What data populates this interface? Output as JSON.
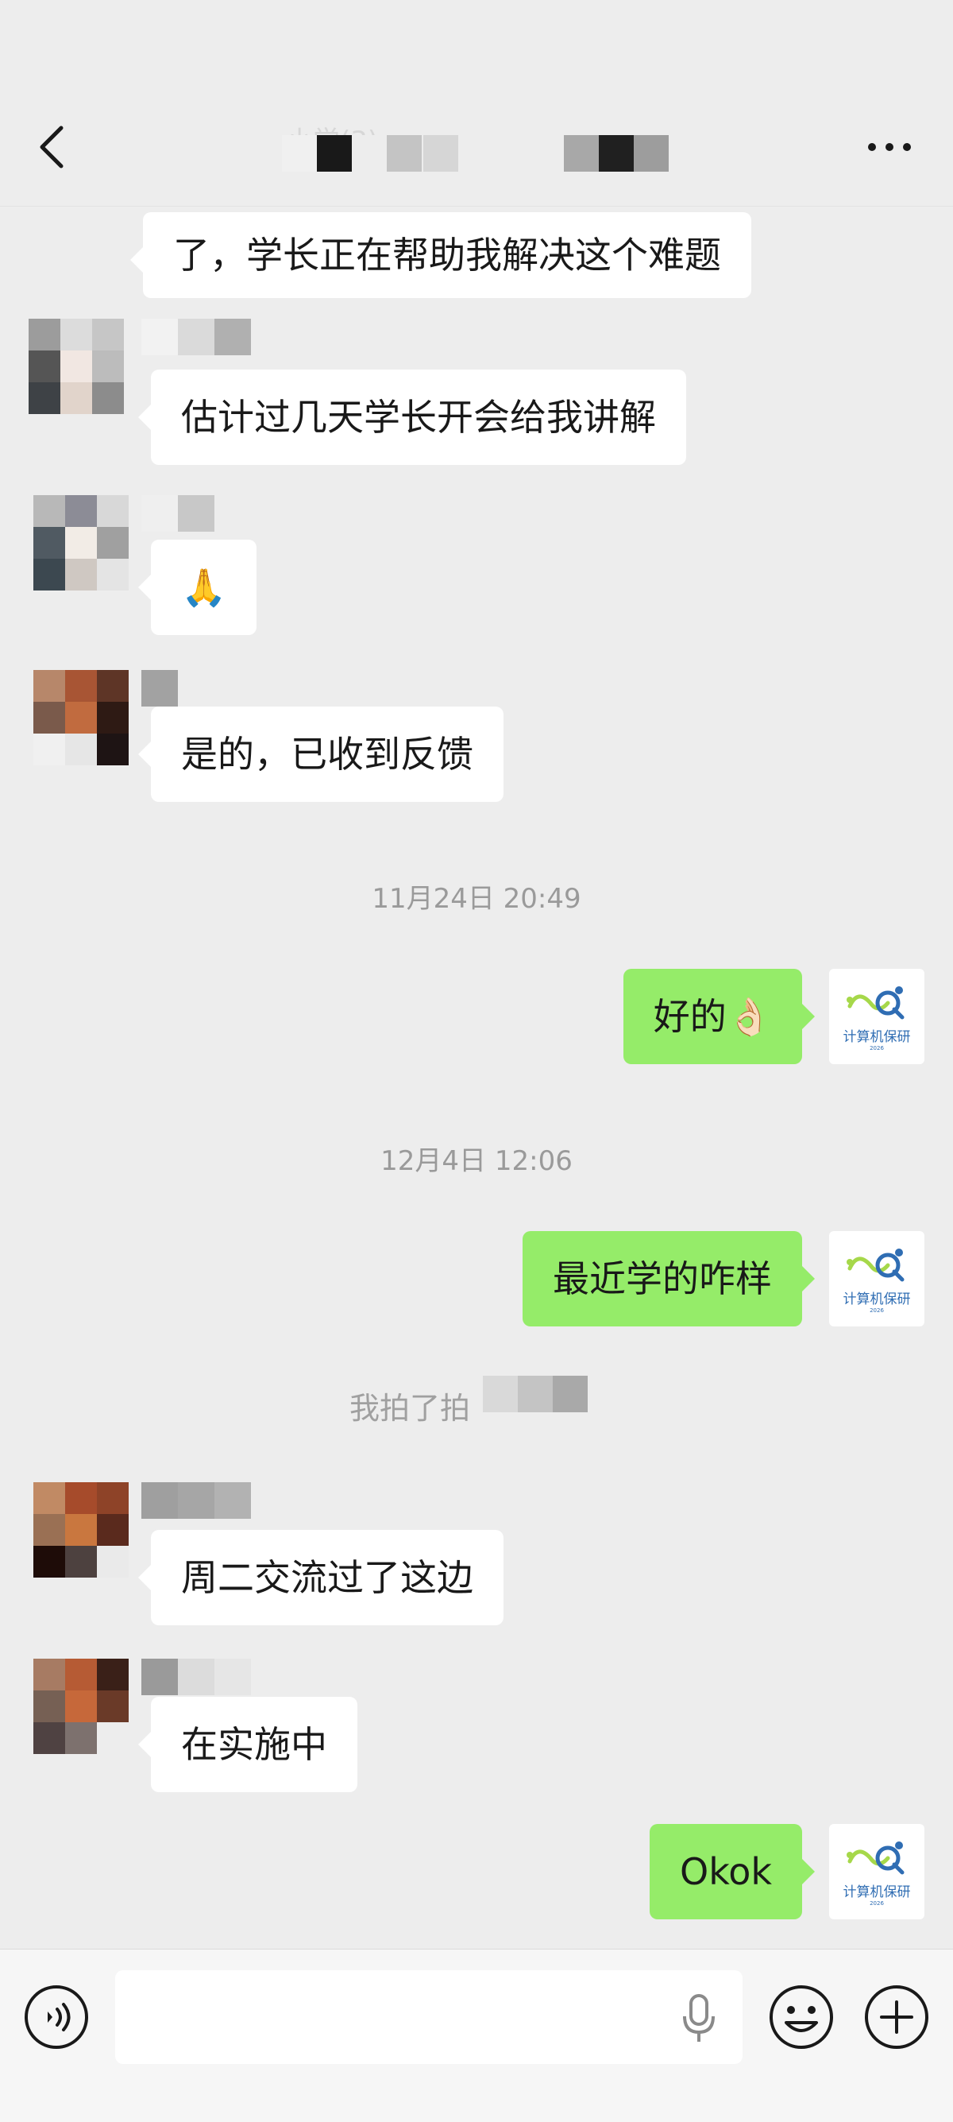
{
  "header": {
    "title": "小学(3)",
    "back_icon": "chevron-left-icon",
    "more_icon": "more-dots-icon"
  },
  "messages": [
    {
      "side": "left",
      "text": "了，学长正在帮助我解决这个难题"
    },
    {
      "side": "left",
      "text": "估计过几天学长开会给我讲解"
    },
    {
      "side": "left",
      "text": "🙏"
    },
    {
      "side": "left",
      "text": "是的，已收到反馈"
    },
    {
      "type": "time",
      "text": "11月24日 20:49"
    },
    {
      "side": "right",
      "text": "好的👌🏻"
    },
    {
      "type": "time",
      "text": "12月4日 12:06"
    },
    {
      "side": "right",
      "text": "最近学的咋样"
    },
    {
      "type": "system",
      "text": "我拍了拍"
    },
    {
      "side": "left",
      "text": "周二交流过了这边"
    },
    {
      "side": "left",
      "text": "在实施中"
    },
    {
      "side": "right",
      "text": "Okok"
    }
  ],
  "self_avatar": {
    "brand": "计算机保研",
    "year": "2026",
    "colors": {
      "green": "#a6d84a",
      "blue": "#2f6db3"
    }
  },
  "input": {
    "value": "",
    "icons": {
      "voice": "voice-wave-icon",
      "mic": "microphone-icon",
      "emoji": "smile-face-icon",
      "plus": "plus-circle-icon"
    }
  },
  "colors": {
    "background": "#ededed",
    "self_bubble": "#95ec69",
    "other_bubble": "#ffffff",
    "timestamp": "#9a9a9a"
  }
}
